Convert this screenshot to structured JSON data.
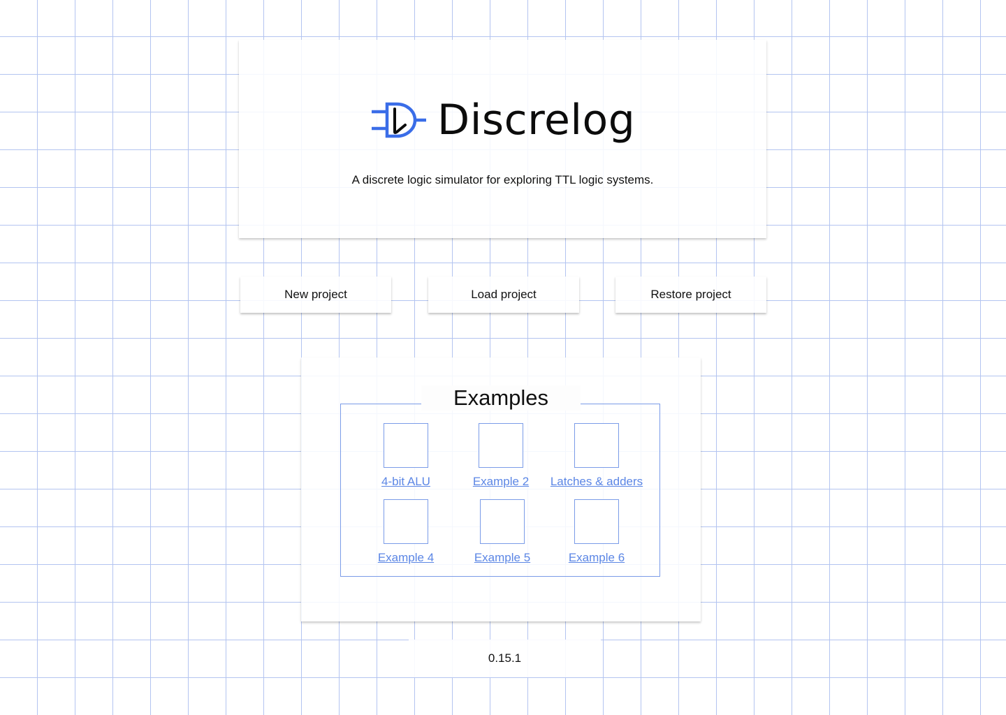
{
  "app": {
    "name": "Discrelog",
    "tagline": "A discrete logic simulator for exploring TTL logic systems.",
    "logo_icon": "logic-gate-d-logo-icon",
    "accent_color": "#3a6de8"
  },
  "actions": {
    "new_label": "New project",
    "load_label": "Load project",
    "restore_label": "Restore project"
  },
  "examples": {
    "title": "Examples",
    "items": [
      {
        "label": "4-bit ALU"
      },
      {
        "label": "Example 2"
      },
      {
        "label": "Latches & adders"
      },
      {
        "label": "Example 4"
      },
      {
        "label": "Example 5"
      },
      {
        "label": "Example 6"
      }
    ]
  },
  "footer": {
    "version": "0.15.1"
  },
  "colors": {
    "grid_line": "#b3c4f0",
    "link": "#5b86e5",
    "border": "#7a9be8"
  }
}
